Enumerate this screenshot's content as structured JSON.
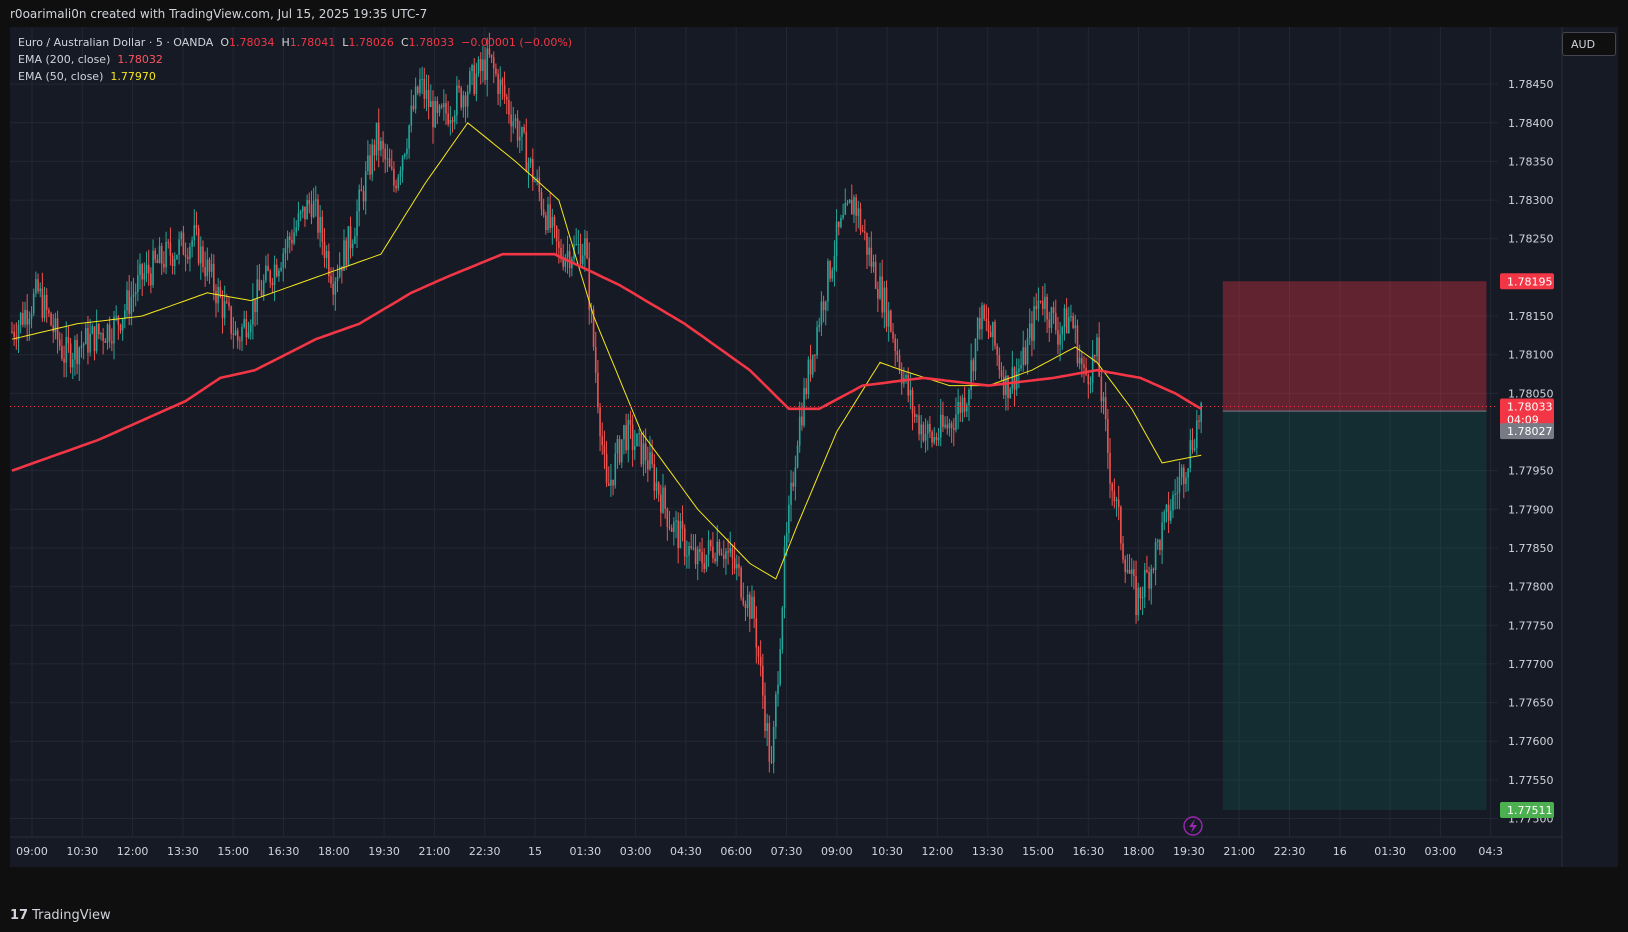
{
  "header": {
    "attribution": "r0oarimali0n created with TradingView.com, Jul 15, 2025 19:35 UTC-7"
  },
  "legend": {
    "symbol": "Euro / Australian Dollar · 5 · OANDA",
    "o_label": "O",
    "o_value": "1.78034",
    "h_label": "H",
    "h_value": "1.78041",
    "l_label": "L",
    "l_value": "1.78026",
    "c_label": "C",
    "c_value": "1.78033",
    "change": "−0.00001 (−0.00%)",
    "ema200_label": "EMA (200, close)",
    "ema200_value": "1.78032",
    "ema50_label": "EMA (50, close)",
    "ema50_value": "1.77970"
  },
  "currency_button": "AUD",
  "footer": {
    "logo_text": "TradingView"
  },
  "colors": {
    "up": "#26a69a",
    "down": "#ef5350",
    "ema200": "#f23645",
    "ema50": "#f5e71d",
    "background": "#161a25"
  },
  "price_tags": {
    "stop": "1.78195",
    "current": "1.78033",
    "countdown": "04:09",
    "entry": "1.78027",
    "target": "1.77511"
  },
  "chart_data": {
    "type": "candlestick",
    "ylim": [
      1.7748,
      1.7852
    ],
    "y_ticks": [
      "1.78450",
      "1.78400",
      "1.78350",
      "1.78300",
      "1.78250",
      "1.78150",
      "1.78100",
      "1.78050",
      "1.77950",
      "1.77900",
      "1.77850",
      "1.77800",
      "1.77750",
      "1.77700",
      "1.77650",
      "1.77600",
      "1.77550",
      "1.77500"
    ],
    "x_ticks": [
      "09:00",
      "10:30",
      "12:00",
      "13:30",
      "15:00",
      "16:30",
      "18:00",
      "19:30",
      "21:00",
      "22:30",
      "15",
      "01:30",
      "03:00",
      "04:30",
      "06:00",
      "07:30",
      "09:00",
      "10:30",
      "12:00",
      "13:30",
      "15:00",
      "16:30",
      "18:00",
      "19:30",
      "21:00",
      "22:30",
      "16",
      "01:30",
      "03:00",
      "04:3"
    ],
    "price_path": [
      [
        0,
        1.7813
      ],
      [
        12,
        1.7818
      ],
      [
        24,
        1.781
      ],
      [
        36,
        1.7812
      ],
      [
        48,
        1.7814
      ],
      [
        60,
        1.782
      ],
      [
        72,
        1.7823
      ],
      [
        84,
        1.7825
      ],
      [
        96,
        1.7817
      ],
      [
        104,
        1.7812
      ],
      [
        112,
        1.7817
      ],
      [
        128,
        1.7825
      ],
      [
        138,
        1.783
      ],
      [
        148,
        1.782
      ],
      [
        156,
        1.7825
      ],
      [
        168,
        1.7838
      ],
      [
        176,
        1.7832
      ],
      [
        188,
        1.7845
      ],
      [
        196,
        1.784
      ],
      [
        208,
        1.7844
      ],
      [
        220,
        1.7848
      ],
      [
        232,
        1.784
      ],
      [
        244,
        1.783
      ],
      [
        252,
        1.7823
      ],
      [
        264,
        1.7824
      ],
      [
        274,
        1.7792
      ],
      [
        282,
        1.78
      ],
      [
        292,
        1.7797
      ],
      [
        304,
        1.7788
      ],
      [
        316,
        1.7783
      ],
      [
        326,
        1.7786
      ],
      [
        334,
        1.7782
      ],
      [
        342,
        1.7776
      ],
      [
        350,
        1.7756
      ],
      [
        356,
        1.7783
      ],
      [
        362,
        1.78
      ],
      [
        372,
        1.7815
      ],
      [
        380,
        1.7825
      ],
      [
        388,
        1.783
      ],
      [
        396,
        1.7822
      ],
      [
        404,
        1.7815
      ],
      [
        410,
        1.7808
      ],
      [
        416,
        1.7802
      ],
      [
        424,
        1.7799
      ],
      [
        432,
        1.7801
      ],
      [
        440,
        1.7805
      ],
      [
        446,
        1.7815
      ],
      [
        452,
        1.7812
      ],
      [
        458,
        1.7806
      ],
      [
        466,
        1.7809
      ],
      [
        474,
        1.7818
      ],
      [
        482,
        1.7813
      ],
      [
        488,
        1.7815
      ],
      [
        494,
        1.7807
      ],
      [
        500,
        1.781
      ],
      [
        506,
        1.7795
      ],
      [
        512,
        1.7785
      ],
      [
        518,
        1.7778
      ],
      [
        524,
        1.7782
      ],
      [
        530,
        1.7787
      ],
      [
        536,
        1.7792
      ],
      [
        542,
        1.7797
      ],
      [
        548,
        1.7803
      ]
    ],
    "ema200_path": [
      [
        0,
        1.7795
      ],
      [
        40,
        1.7799
      ],
      [
        80,
        1.7804
      ],
      [
        96,
        1.7807
      ],
      [
        112,
        1.7808
      ],
      [
        140,
        1.7812
      ],
      [
        160,
        1.7814
      ],
      [
        184,
        1.7818
      ],
      [
        200,
        1.782
      ],
      [
        226,
        1.7823
      ],
      [
        250,
        1.7823
      ],
      [
        280,
        1.7819
      ],
      [
        310,
        1.7814
      ],
      [
        340,
        1.7808
      ],
      [
        358,
        1.7803
      ],
      [
        372,
        1.7803
      ],
      [
        392,
        1.7806
      ],
      [
        420,
        1.7807
      ],
      [
        450,
        1.7806
      ],
      [
        480,
        1.7807
      ],
      [
        500,
        1.7808
      ],
      [
        520,
        1.7807
      ],
      [
        536,
        1.7805
      ],
      [
        548,
        1.7803
      ]
    ],
    "ema50_path": [
      [
        0,
        1.7812
      ],
      [
        30,
        1.7814
      ],
      [
        60,
        1.7815
      ],
      [
        90,
        1.7818
      ],
      [
        110,
        1.7817
      ],
      [
        140,
        1.782
      ],
      [
        170,
        1.7823
      ],
      [
        190,
        1.7832
      ],
      [
        210,
        1.784
      ],
      [
        232,
        1.7835
      ],
      [
        252,
        1.783
      ],
      [
        268,
        1.7815
      ],
      [
        290,
        1.78
      ],
      [
        316,
        1.779
      ],
      [
        340,
        1.7783
      ],
      [
        352,
        1.7781
      ],
      [
        362,
        1.7788
      ],
      [
        380,
        1.78
      ],
      [
        400,
        1.7809
      ],
      [
        410,
        1.7808
      ],
      [
        432,
        1.7806
      ],
      [
        450,
        1.7806
      ],
      [
        470,
        1.7808
      ],
      [
        490,
        1.7811
      ],
      [
        500,
        1.7809
      ],
      [
        516,
        1.7803
      ],
      [
        530,
        1.7796
      ],
      [
        548,
        1.7797
      ]
    ],
    "position": {
      "side": "short",
      "entry": 1.78027,
      "stop": 1.78195,
      "target": 1.77511,
      "start_index": 552,
      "end_index": 650
    }
  }
}
